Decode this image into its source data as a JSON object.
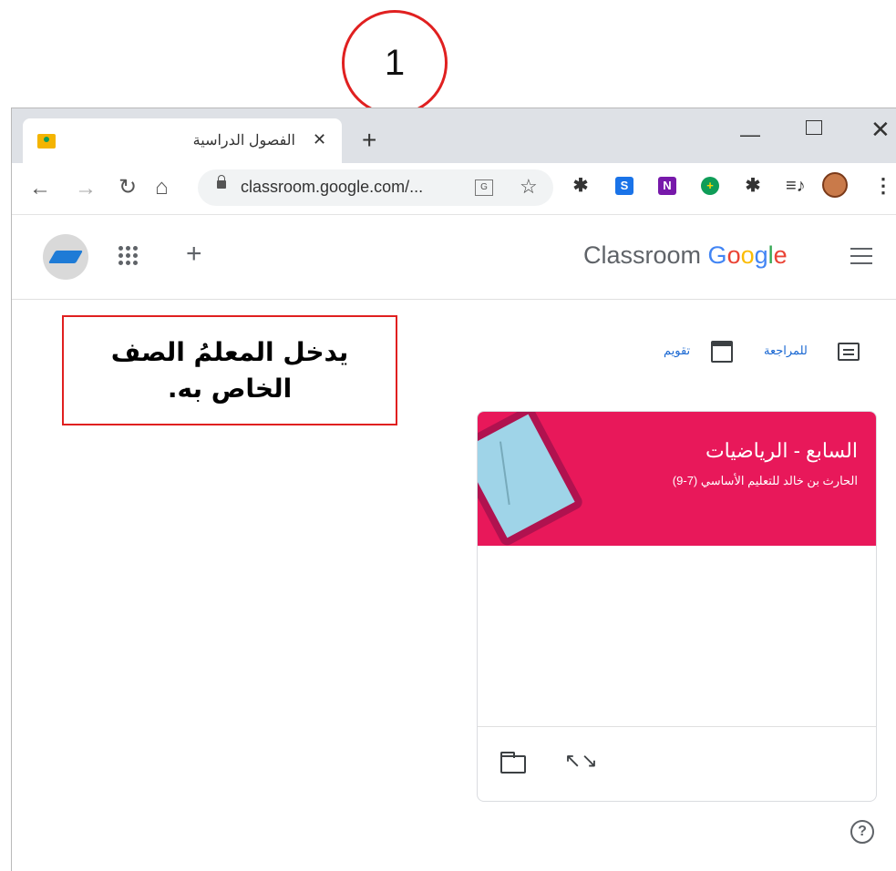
{
  "annotation": {
    "step_number": "1"
  },
  "browser": {
    "tab_title": "الفصول الدراسية",
    "url": "classroom.google.com/...",
    "new_tab_symbol": "+",
    "extensions": [
      "puzzle-green-icon",
      "s-icon",
      "onenote-icon",
      "plus-icon",
      "puzzle-icon",
      "media-icon"
    ]
  },
  "header": {
    "brand_classroom": "Classroom",
    "brand_google_letters": [
      "G",
      "o",
      "o",
      "g",
      "l",
      "e"
    ],
    "brand_colors": [
      "#4285f4",
      "#ea4335",
      "#fbbc05",
      "#4285f4",
      "#34a853",
      "#ea4335"
    ]
  },
  "callout": {
    "line1": "يدخل المعلمُ الصف",
    "line2": "الخاص به."
  },
  "subnav": {
    "todo_label": "للمراجعة",
    "calendar_label": "تقويم"
  },
  "class_card": {
    "title": "السابع - الرياضيات",
    "subtitle": "الحارث بن خالد للتعليم الأساسي (7-9)",
    "banner_color": "#e8185a"
  }
}
